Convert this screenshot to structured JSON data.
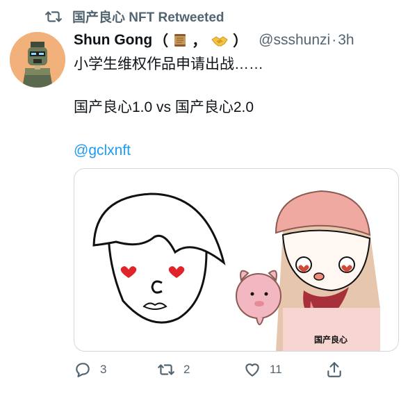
{
  "retweet_banner": {
    "text": "国产良心 NFT Retweeted"
  },
  "tweet": {
    "author": {
      "display_name": "Shun Gong",
      "paren_open": "（",
      "comma": "，",
      "paren_close": "）",
      "handle": "@ssshunzi",
      "separator": "·",
      "timestamp": "3h"
    },
    "text": {
      "line1": "小学生维权作品申请出战……",
      "line2": "国产良心1.0 vs 国产良心2.0",
      "mention": "@gclxnft"
    },
    "media": {
      "label": "国产良心",
      "colors": {
        "heart": "#e0242a",
        "hat": "#f0a9a0",
        "hair": "#e6c7ae",
        "pig": "#f3b7c1"
      }
    },
    "actions": {
      "reply_count": "3",
      "retweet_count": "2",
      "like_count": "11"
    }
  },
  "theme": {
    "muted": "#536471",
    "link": "#1d9bf0",
    "border": "#cfd9de"
  }
}
